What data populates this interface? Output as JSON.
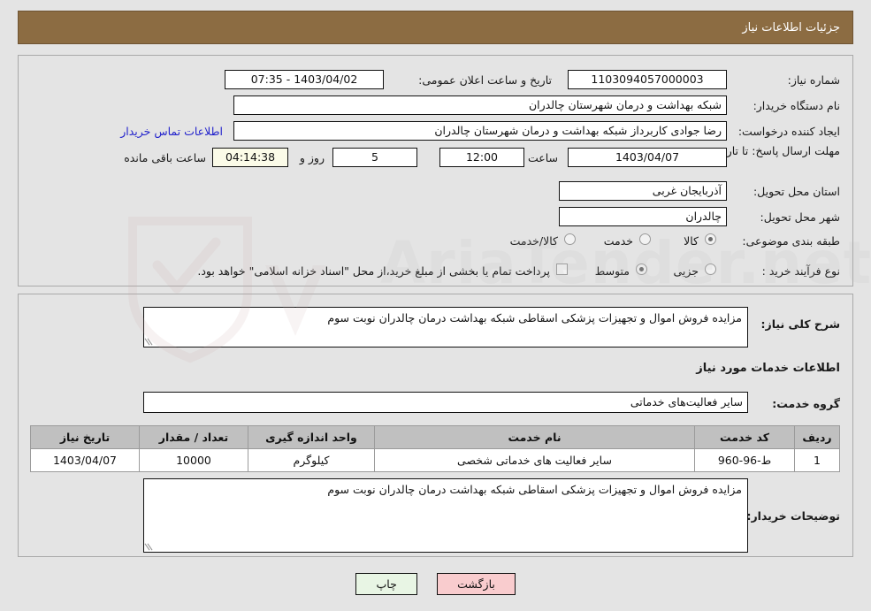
{
  "header": {
    "title": "جزئیات اطلاعات نیاز"
  },
  "colors": {
    "header_bg": "#8c6c42",
    "panel_bg": "#e4e4e4",
    "link": "#2222cc",
    "table_header_bg": "#c0c0c0",
    "print_btn_bg": "#e8f5e4",
    "back_btn_bg": "#f9ccce",
    "timer_bg": "#fbfbe8"
  },
  "form": {
    "need_number_label": "شماره نیاز:",
    "need_number_value": "1103094057000003",
    "announce_label": "تاریخ و ساعت اعلان عمومی:",
    "announce_value": "1403/04/02 - 07:35",
    "buyer_org_label": "نام دستگاه خریدار:",
    "buyer_org_value": "شبکه بهداشت و درمان شهرستان چالدران",
    "creator_label": "ایجاد کننده درخواست:",
    "creator_value": "رضا جوادی کاربرداز شبکه بهداشت و درمان شهرستان چالدران",
    "contact_link": "اطلاعات تماس خریدار",
    "deadline_label": "مهلت ارسال پاسخ: تا تاریخ:",
    "deadline_date": "1403/04/07",
    "hour_label": "ساعت",
    "deadline_time": "12:00",
    "days_remaining": "5",
    "day_and_label": "روز و",
    "timer_value": "04:14:38",
    "hours_remaining_label": "ساعت باقی مانده",
    "province_label": "استان محل تحویل:",
    "province_value": "آذربایجان غربی",
    "city_label": "شهر محل تحویل:",
    "city_value": "چالدران",
    "category_label": "طبقه بندی موضوعی:",
    "category_options": [
      {
        "label": "کالا",
        "selected": false
      },
      {
        "label": "خدمت",
        "selected": true
      },
      {
        "label": "کالا/خدمت",
        "selected": false
      }
    ],
    "process_label": "نوع فرآیند خرید :",
    "process_options": [
      {
        "label": "جزیی",
        "selected": false
      },
      {
        "label": "متوسط",
        "selected": true
      }
    ],
    "treasury_checkbox_checked": false,
    "treasury_text": "پرداخت تمام یا بخشی از مبلغ خرید،از محل \"اسناد خزانه اسلامی\" خواهد بود."
  },
  "description": {
    "general_label": "شرح کلی نیاز:",
    "general_value": "مزایده فروش اموال و تجهیزات پزشکی اسقاطی شبکه بهداشت درمان چالدران نوبت سوم",
    "section_title": "اطلاعات خدمات مورد نیاز",
    "service_group_label": "گروه خدمت:",
    "service_group_value": "سایر فعالیت‌های خدماتی"
  },
  "table": {
    "columns": [
      "ردیف",
      "کد خدمت",
      "نام خدمت",
      "واحد اندازه گیری",
      "تعداد / مقدار",
      "تاریخ نیاز"
    ],
    "rows": [
      {
        "row": "1",
        "code": "ط-96-960",
        "name": "سایر فعالیت های خدماتی شخصی",
        "unit": "کیلوگرم",
        "quantity": "10000",
        "date": "1403/04/07"
      }
    ]
  },
  "buyer_notes": {
    "label": "توضیحات خریدار:",
    "value": "مزایده فروش اموال و تجهیزات پزشکی اسقاطی شبکه بهداشت درمان چالدران نوبت سوم"
  },
  "buttons": {
    "print": "چاپ",
    "back": "بازگشت"
  },
  "watermark": {
    "text": "AriaTender.net"
  }
}
